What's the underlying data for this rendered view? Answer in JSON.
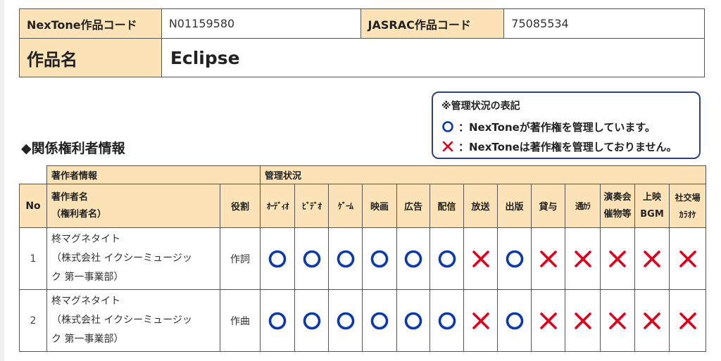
{
  "colors": {
    "managed": "#0b3aa8",
    "not_managed": "#e0001a",
    "label_bg": "#fbe3b7",
    "legend_border": "#29447a"
  },
  "info": {
    "nextone_code_label": "NexTone作品コード",
    "nextone_code_value": "N01159580",
    "jasrac_code_label": "JASRAC作品コード",
    "jasrac_code_value": "75085534",
    "title_label": "作品名",
    "title_value": "Eclipse"
  },
  "legend": {
    "title": "※管理状況の表記",
    "managed_text": "：NexToneが著作権を管理しています。",
    "not_managed_text": "：NexToneは著作権を管理しておりません。"
  },
  "section_title": "◆関係権利者情報",
  "table": {
    "group_author": "著作者情報",
    "group_status": "管理状況",
    "col_no": "No",
    "col_author_line1": "著作者名",
    "col_author_line2": "（権利者名）",
    "col_role": "役割",
    "status_columns": [
      {
        "line1": "ｵｰﾃﾞｨｵ",
        "line2": ""
      },
      {
        "line1": "ﾋﾞﾃﾞｵ",
        "line2": ""
      },
      {
        "line1": "ｹﾞｰﾑ",
        "line2": ""
      },
      {
        "line1": "映画",
        "line2": ""
      },
      {
        "line1": "広告",
        "line2": ""
      },
      {
        "line1": "配信",
        "line2": ""
      },
      {
        "line1": "放送",
        "line2": ""
      },
      {
        "line1": "出版",
        "line2": ""
      },
      {
        "line1": "貸与",
        "line2": ""
      },
      {
        "line1": "通ｶﾗ",
        "line2": ""
      },
      {
        "line1": "演奏会",
        "line2": "催物等"
      },
      {
        "line1": "上映",
        "line2": "BGM"
      },
      {
        "line1": "社交場",
        "line2": "ｶﾗｵｹ"
      }
    ],
    "rows": [
      {
        "no": "1",
        "author_line1": "柊マグネタイト",
        "author_line2": "（株式会社 イクシーミュージッ",
        "author_line3": "ク 第一事業部）",
        "role": "作詞",
        "status": [
          "managed",
          "managed",
          "managed",
          "managed",
          "managed",
          "managed",
          "not_managed",
          "managed",
          "not_managed",
          "not_managed",
          "not_managed",
          "not_managed",
          "not_managed"
        ]
      },
      {
        "no": "2",
        "author_line1": "柊マグネタイト",
        "author_line2": "（株式会社 イクシーミュージッ",
        "author_line3": "ク 第一事業部）",
        "role": "作曲",
        "status": [
          "managed",
          "managed",
          "managed",
          "managed",
          "managed",
          "managed",
          "not_managed",
          "managed",
          "not_managed",
          "not_managed",
          "not_managed",
          "not_managed",
          "not_managed"
        ]
      }
    ]
  }
}
